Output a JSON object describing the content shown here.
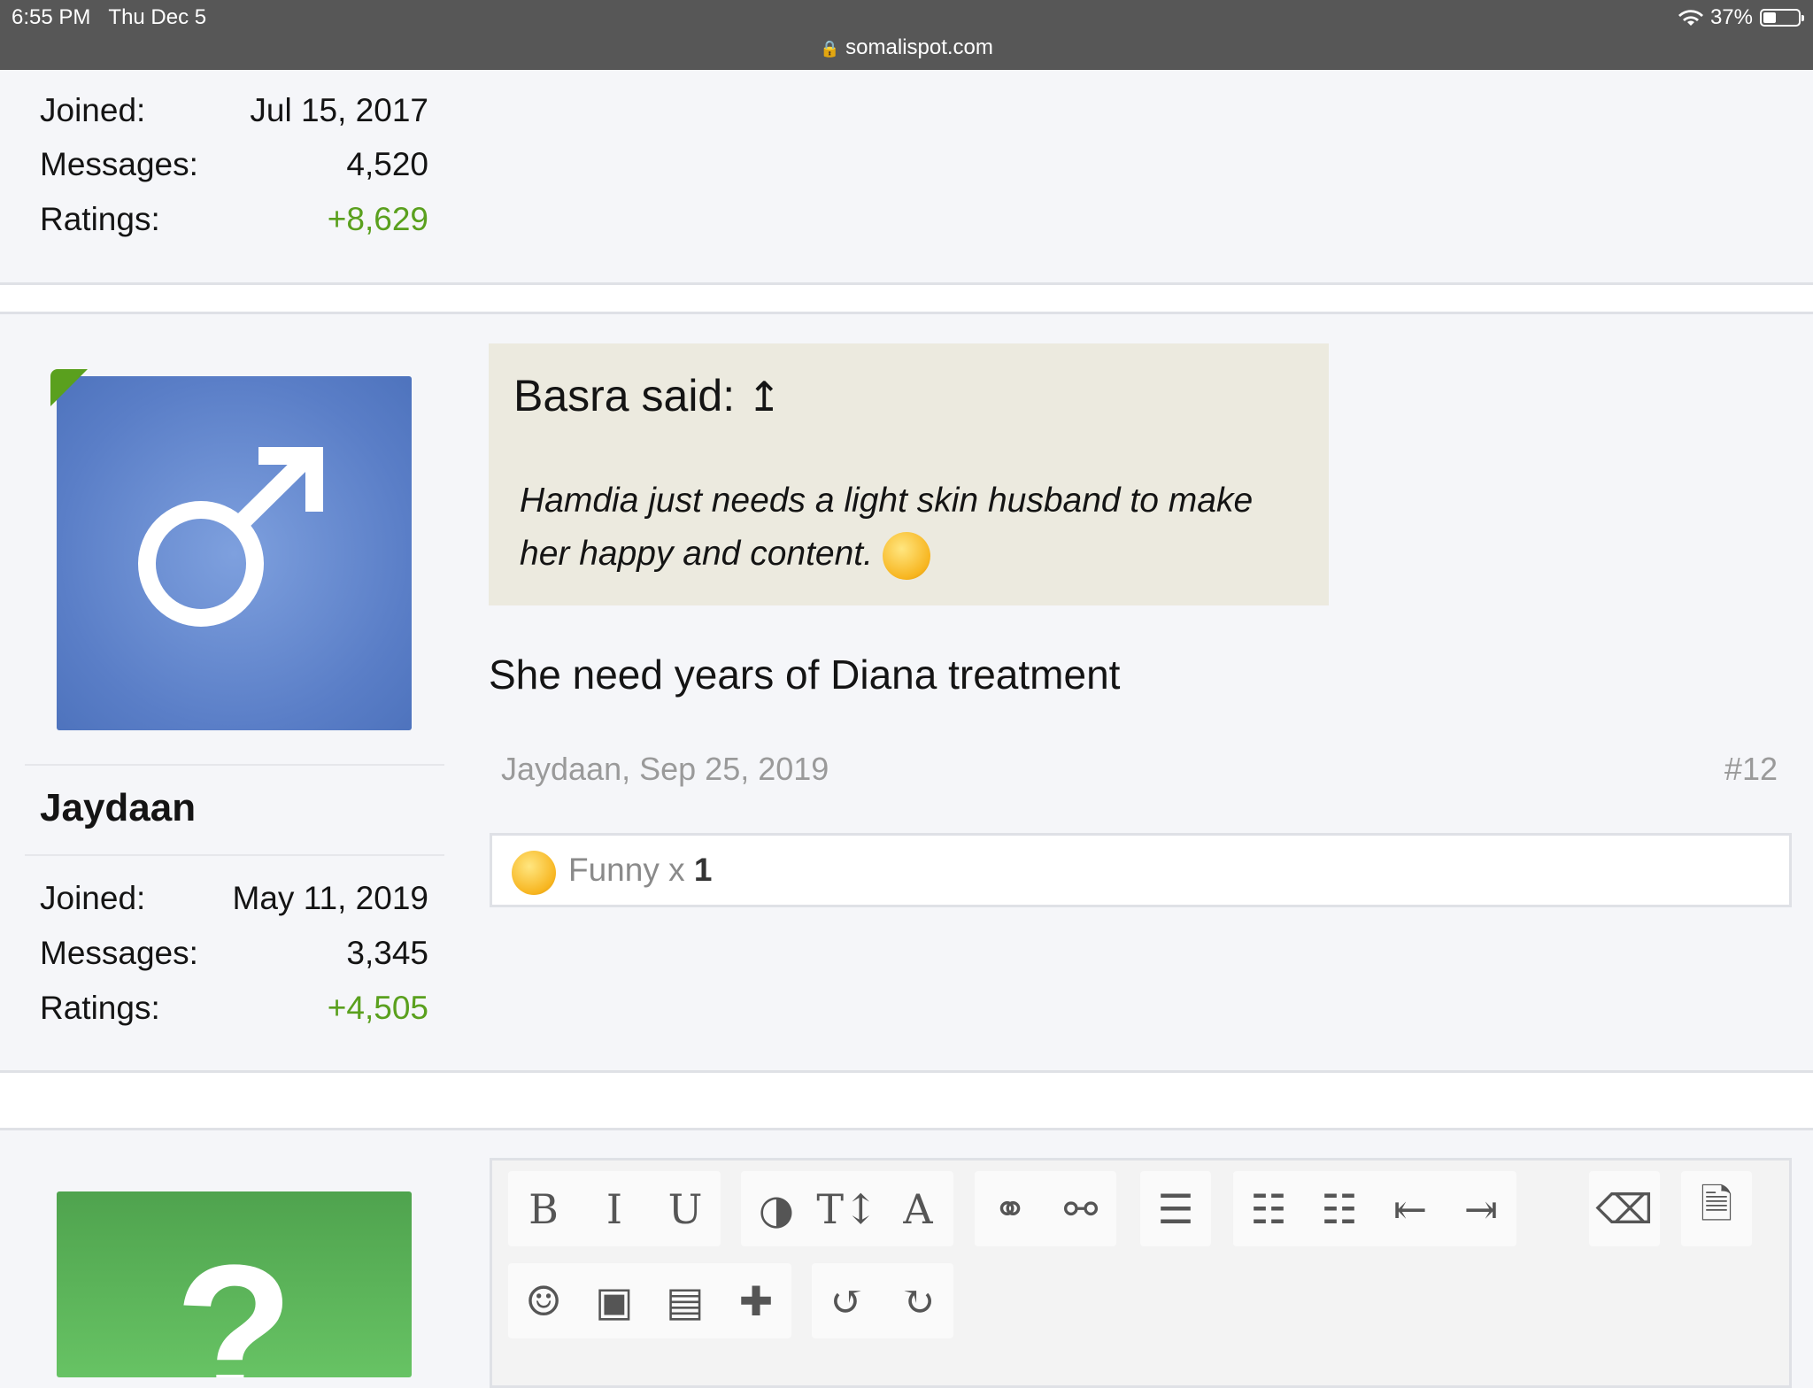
{
  "status_bar": {
    "time": "6:55 PM",
    "date": "Thu Dec 5",
    "url": "somalispot.com",
    "battery": "37%"
  },
  "prev_user": {
    "joined_label": "Joined:",
    "joined": "Jul 15, 2017",
    "messages_label": "Messages:",
    "messages": "4,520",
    "ratings_label": "Ratings:",
    "ratings": "+8,629"
  },
  "post": {
    "username": "Jaydaan",
    "joined_label": "Joined:",
    "joined": "May 11, 2019",
    "messages_label": "Messages:",
    "messages": "3,345",
    "ratings_label": "Ratings:",
    "ratings": "+4,505",
    "quote_author": "Basra said:",
    "quote_arrow": "↥",
    "quote_text": "Hamdia just needs a light skin husband to make her happy and content.",
    "body": "She need years of Diana treatment",
    "meta": "Jaydaan, Sep 25, 2019",
    "number": "#12",
    "reaction_label": "Funny x",
    "reaction_count": "1"
  },
  "next_avatar_char": "?",
  "editor": {
    "row1": [
      {
        "icon": "bold-icon",
        "glyph": "B"
      },
      {
        "icon": "italic-icon",
        "glyph": "I"
      },
      {
        "icon": "underline-icon",
        "glyph": "U"
      },
      {
        "icon": "color-icon",
        "glyph": "◑"
      },
      {
        "icon": "font-size-icon",
        "glyph": "T↕"
      },
      {
        "icon": "font-family-icon",
        "glyph": "A"
      },
      {
        "icon": "link-icon",
        "glyph": "⚭"
      },
      {
        "icon": "unlink-icon",
        "glyph": "⚯"
      },
      {
        "icon": "align-icon",
        "glyph": "☰"
      },
      {
        "icon": "bullet-list-icon",
        "glyph": "☷"
      },
      {
        "icon": "numbered-list-icon",
        "glyph": "☷"
      },
      {
        "icon": "outdent-icon",
        "glyph": "⇤"
      },
      {
        "icon": "indent-icon",
        "glyph": "⇥"
      },
      {
        "icon": "eraser-icon",
        "glyph": "⌫"
      },
      {
        "icon": "document-icon",
        "glyph": "🗎"
      }
    ],
    "row2": [
      {
        "icon": "smilie-icon",
        "glyph": "☺"
      },
      {
        "icon": "image-icon",
        "glyph": "▣"
      },
      {
        "icon": "media-icon",
        "glyph": "▤"
      },
      {
        "icon": "insert-icon",
        "glyph": "✚"
      },
      {
        "icon": "undo-icon",
        "glyph": "↺"
      },
      {
        "icon": "redo-icon",
        "glyph": "↻"
      }
    ]
  }
}
